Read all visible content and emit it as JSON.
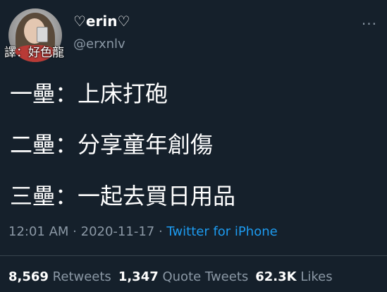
{
  "header": {
    "display_name": "♡erin♡",
    "handle": "@erxnlv",
    "translator_label": "譯：好色龍",
    "more_icon": "more-horizontal-icon",
    "more_glyph": "···"
  },
  "content": {
    "lines": [
      "一壘：上床打砲",
      "二壘：分享童年創傷",
      "三壘：一起去買日用品"
    ]
  },
  "meta": {
    "time": "12:01 AM",
    "separator": " · ",
    "date": "2020-11-17",
    "source": "Twitter for iPhone"
  },
  "stats": {
    "retweets_count": "8,569",
    "retweets_label": "Retweets",
    "quotes_count": "1,347",
    "quotes_label": "Quote Tweets",
    "likes_count": "62.3K",
    "likes_label": "Likes"
  },
  "colors": {
    "background": "#15202b",
    "text": "#ffffff",
    "secondary": "#8b98a5",
    "link": "#1d9bf0"
  }
}
